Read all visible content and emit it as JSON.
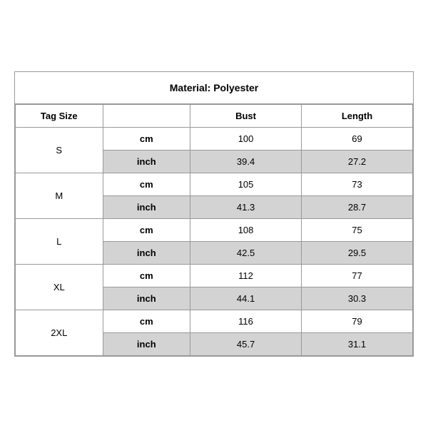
{
  "header": {
    "material": "Material: Polyester"
  },
  "columns": {
    "tag_size": "Tag Size",
    "bust": "Bust",
    "length": "Length"
  },
  "rows": [
    {
      "size": "S",
      "cm_bust": "100",
      "cm_length": "69",
      "inch_bust": "39.4",
      "inch_length": "27.2"
    },
    {
      "size": "M",
      "cm_bust": "105",
      "cm_length": "73",
      "inch_bust": "41.3",
      "inch_length": "28.7"
    },
    {
      "size": "L",
      "cm_bust": "108",
      "cm_length": "75",
      "inch_bust": "42.5",
      "inch_length": "29.5"
    },
    {
      "size": "XL",
      "cm_bust": "112",
      "cm_length": "77",
      "inch_bust": "44.1",
      "inch_length": "30.3"
    },
    {
      "size": "2XL",
      "cm_bust": "116",
      "cm_length": "79",
      "inch_bust": "45.7",
      "inch_length": "31.1"
    }
  ],
  "units": {
    "cm": "cm",
    "inch": "inch"
  }
}
